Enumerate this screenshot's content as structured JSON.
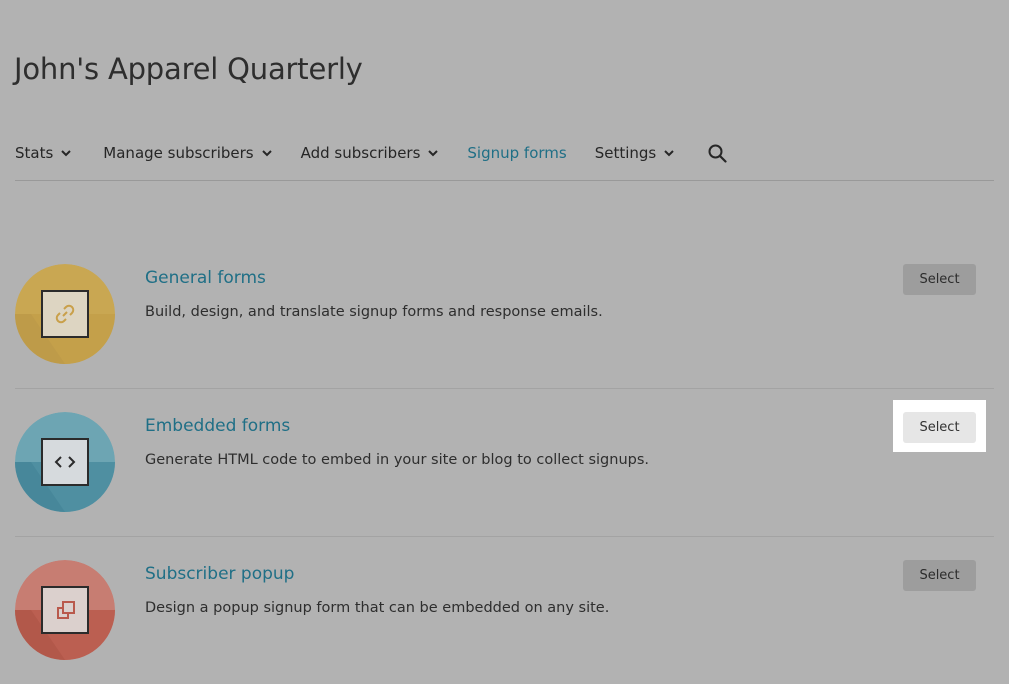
{
  "page": {
    "title": "John's Apparel Quarterly"
  },
  "nav": {
    "items": [
      {
        "label": "Stats",
        "dropdown": true,
        "active": false
      },
      {
        "label": "Manage subscribers",
        "dropdown": true,
        "active": false
      },
      {
        "label": "Add subscribers",
        "dropdown": true,
        "active": false
      },
      {
        "label": "Signup forms",
        "dropdown": false,
        "active": true
      },
      {
        "label": "Settings",
        "dropdown": true,
        "active": false
      }
    ],
    "search_icon": "search-icon"
  },
  "forms": [
    {
      "title": "General forms",
      "description": "Build, design, and translate signup forms and response emails.",
      "icon": "link-icon",
      "color": "#c9a752",
      "button": "Select",
      "highlighted": false
    },
    {
      "title": "Embedded forms",
      "description": "Generate HTML code to embed in your site or blog to collect signups.",
      "icon": "code-icon",
      "color": "#5a9aaa",
      "button": "Select",
      "highlighted": true
    },
    {
      "title": "Subscriber popup",
      "description": "Design a popup signup form that can be embedded on any site.",
      "icon": "popup-icon",
      "color": "#b8665b",
      "button": "Select",
      "highlighted": false
    }
  ],
  "colors": {
    "background": "#b2b2b2",
    "accent": "#1f6f86",
    "highlight": "#ffffff"
  }
}
